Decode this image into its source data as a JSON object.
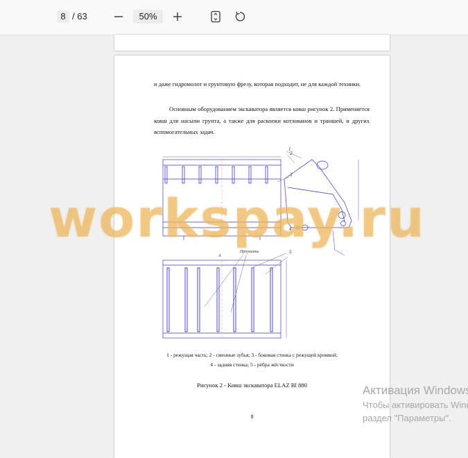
{
  "toolbar": {
    "current_page": "8",
    "total_pages": "/ 63",
    "zoom": "50%",
    "icons": [
      "minus-icon",
      "plus-icon",
      "fit-page-icon",
      "rotate-icon"
    ]
  },
  "document": {
    "paragraph1": "и даже гидромолот и грунтовую фрезу, которая подходит, не для каждой техники.",
    "paragraph2": "Основным оборудованием экскаватора является ковш рисунок 2. Применяется ковш для насыпи грунта, а также для раскопки котлованов и траншей, и других вспомогательных задач.",
    "caption_line1": "1 - режущая часть; 2 - сменные зубья; 3 - боковая стенка с режущей кромкой;",
    "caption_line2": "4 - задняя стенка; 5 - рёбра жёсткости",
    "figure_title": "Рисунок 2 - Ковш экскаватора ELAZ Bl 880",
    "page_number": "8",
    "drawing_labels": {
      "l1": "1",
      "l2": "2",
      "l3": "3",
      "l4": "4",
      "l5": "5",
      "l6": "Проушины",
      "l7": "А"
    }
  },
  "watermark": "workspay.ru",
  "activation": {
    "title": "Активация Windows",
    "line1": "Чтобы активировать Windows, перейдите в",
    "line2": "раздел \"Параметры\"."
  },
  "colors": {
    "drawing_line": "#3a35c8",
    "watermark": "#ecb45a"
  }
}
